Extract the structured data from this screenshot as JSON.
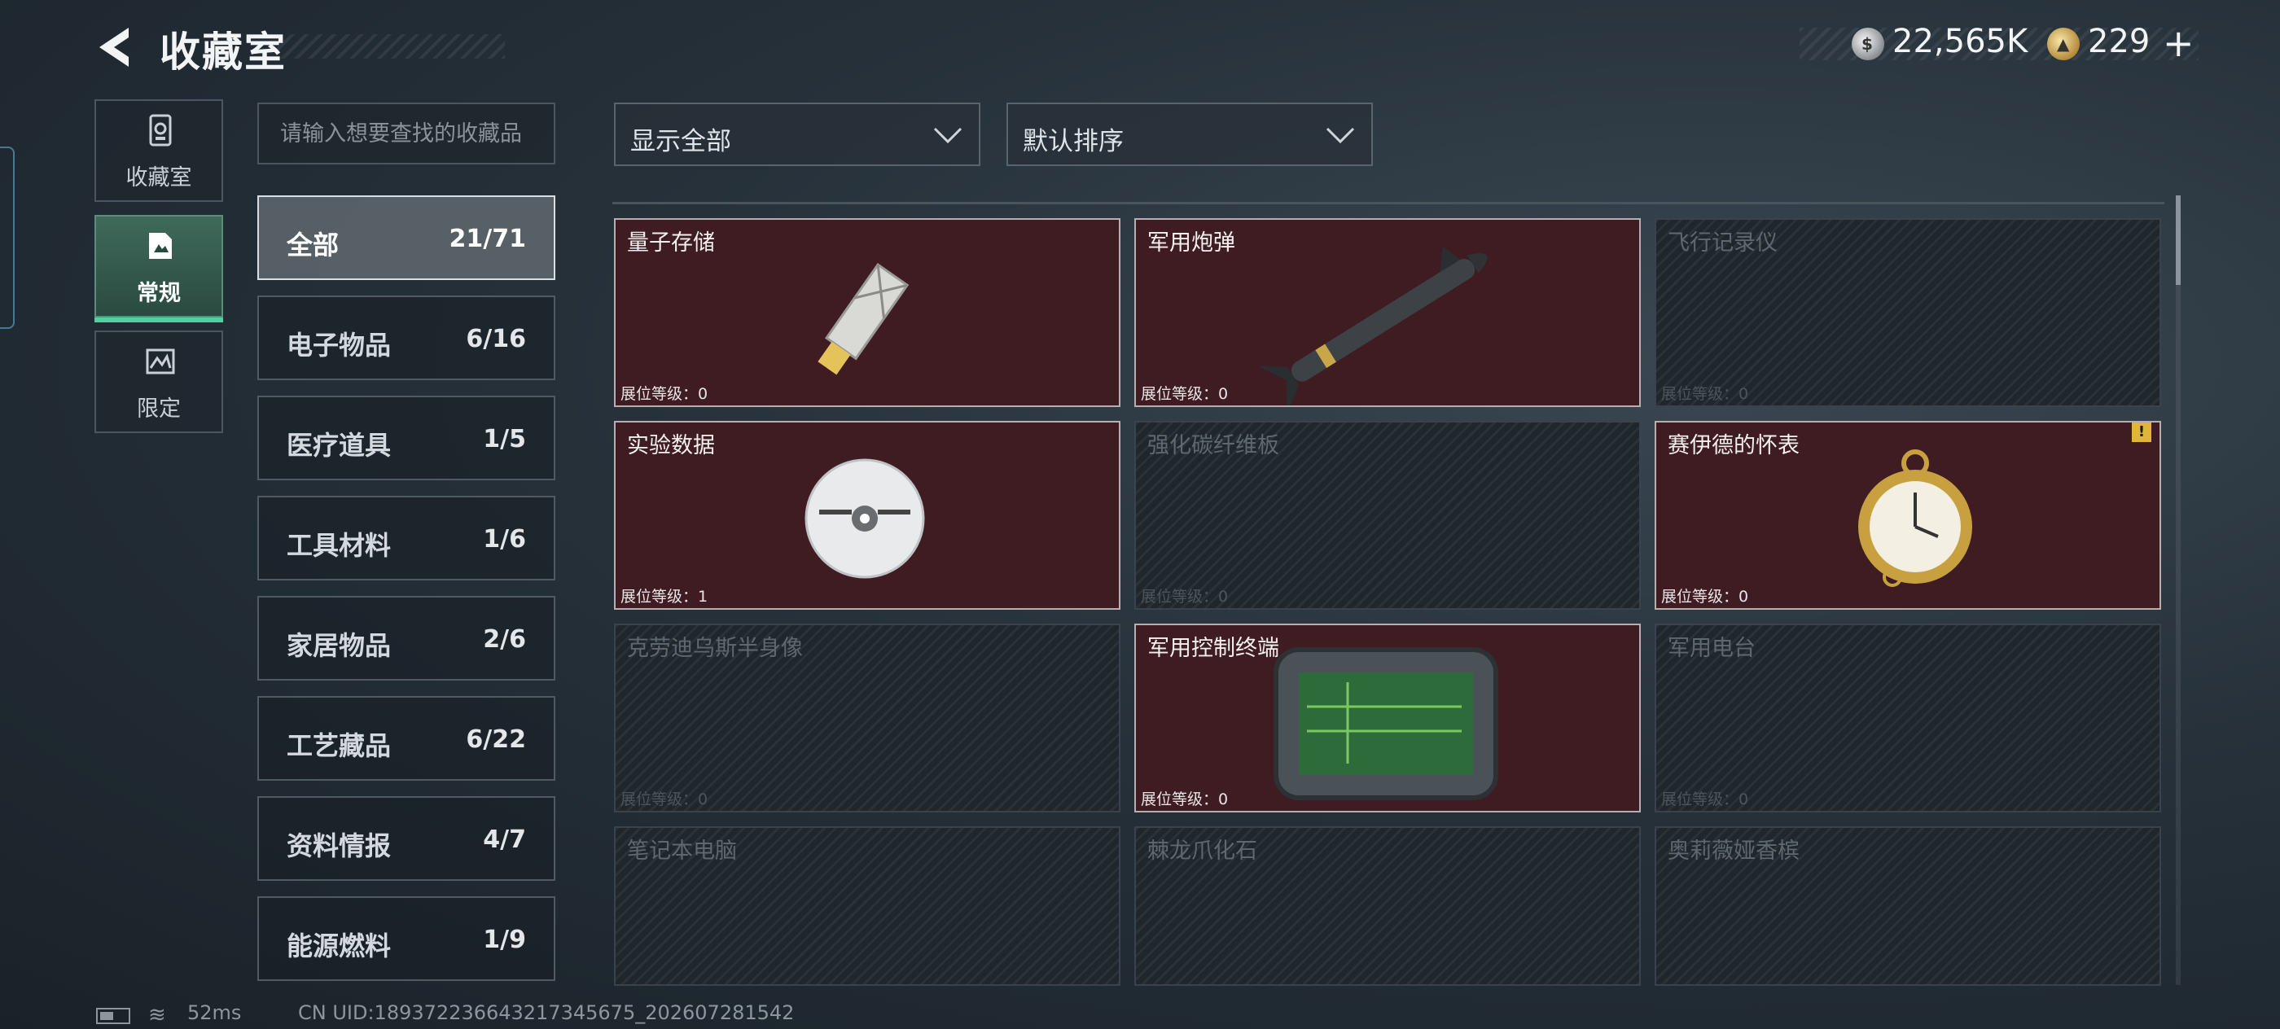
{
  "header": {
    "title": "收藏室",
    "money": "22,565K",
    "tokens": "229",
    "plus_symbol": "+"
  },
  "rail": {
    "tabs": [
      {
        "label": "收藏室",
        "icon": "collection-room-icon",
        "active": false
      },
      {
        "label": "常规",
        "icon": "regular-icon",
        "active": true
      },
      {
        "label": "限定",
        "icon": "limited-icon",
        "active": false
      }
    ]
  },
  "search": {
    "placeholder": "请输入想要查找的收藏品",
    "value": ""
  },
  "categories": [
    {
      "name": "全部",
      "count": "21/71",
      "active": true
    },
    {
      "name": "电子物品",
      "count": "6/16"
    },
    {
      "name": "医疗道具",
      "count": "1/5"
    },
    {
      "name": "工具材料",
      "count": "1/6"
    },
    {
      "name": "家居物品",
      "count": "2/6"
    },
    {
      "name": "工艺藏品",
      "count": "6/22"
    },
    {
      "name": "资料情报",
      "count": "4/7"
    },
    {
      "name": "能源燃料",
      "count": "1/9"
    }
  ],
  "filters": {
    "display": "显示全部",
    "sort": "默认排序"
  },
  "items": [
    {
      "name": "量子存储",
      "level": "展位等级：0",
      "owned": true,
      "icon": "usb-drive-icon"
    },
    {
      "name": "军用炮弹",
      "level": "展位等级：0",
      "owned": true,
      "icon": "missile-icon"
    },
    {
      "name": "飞行记录仪",
      "level": "展位等级：0",
      "owned": false,
      "icon": "flight-recorder-icon"
    },
    {
      "name": "实验数据",
      "level": "展位等级：1",
      "owned": true,
      "icon": "disc-icon"
    },
    {
      "name": "强化碳纤维板",
      "level": "展位等级：0",
      "owned": false,
      "icon": "carbon-plate-icon"
    },
    {
      "name": "赛伊德的怀表",
      "level": "展位等级：0",
      "owned": true,
      "icon": "pocket-watch-icon",
      "warning": "!"
    },
    {
      "name": "克劳迪乌斯半身像",
      "level": "展位等级：0",
      "owned": false,
      "icon": "bust-icon"
    },
    {
      "name": "军用控制终端",
      "level": "展位等级：0",
      "owned": true,
      "icon": "control-terminal-icon"
    },
    {
      "name": "军用电台",
      "level": "展位等级：0",
      "owned": false,
      "icon": "radio-icon"
    },
    {
      "name": "笔记本电脑",
      "level": "",
      "owned": false,
      "icon": "laptop-icon"
    },
    {
      "name": "棘龙爪化石",
      "level": "",
      "owned": false,
      "icon": "fossil-claw-icon"
    },
    {
      "name": "奥莉薇娅香槟",
      "level": "",
      "owned": false,
      "icon": "champagne-icon"
    }
  ],
  "status": {
    "ping": "52ms",
    "uid": "CN UID:18937223664321734567​5_202607281542"
  },
  "colors": {
    "owned_card": "#3f1c22",
    "locked_card": "#1f262c",
    "accent": "#4fd1a2",
    "warning": "#e0b63a"
  }
}
